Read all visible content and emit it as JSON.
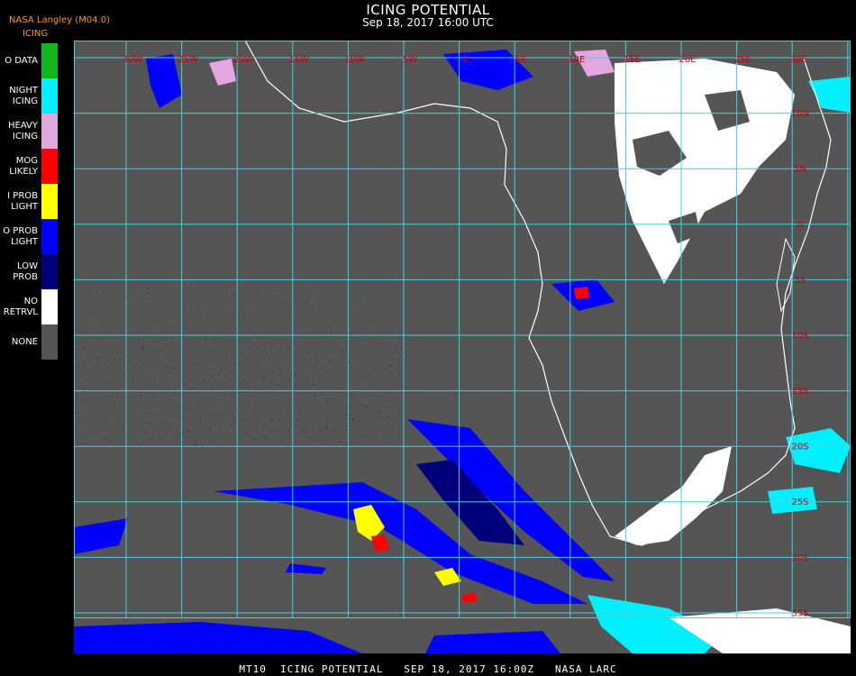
{
  "header": {
    "title": "ICING POTENTIAL",
    "datetime": "Sep 18, 2017 16:00 UTC",
    "source": "NASA Langley (M04.0)",
    "product": "ICING"
  },
  "legend": [
    {
      "label": "O DATA",
      "color": "#11b81b"
    },
    {
      "label": "NIGHT\nICING",
      "color": "#00f0ff"
    },
    {
      "label": "HEAVY\nICING",
      "color": "#e3a6e0"
    },
    {
      "label": "MOG\nLIKELY",
      "color": "#ff0000"
    },
    {
      "label": "I PROB\nLIGHT",
      "color": "#ffff00"
    },
    {
      "label": "O PROB\nLIGHT",
      "color": "#0000ff"
    },
    {
      "label": "LOW\nPROB",
      "color": "#00007a"
    },
    {
      "label": "NO\nRETRVL",
      "color": "#ffffff"
    },
    {
      "label": "NONE",
      "color": "#555555"
    }
  ],
  "map": {
    "background_color": "#555555",
    "grid_color": "#3fd3df",
    "coast_color": "#ffffff",
    "label_color": "#cc0000",
    "lon_labels": [
      "30W",
      "25W",
      "20W",
      "15W",
      "10W",
      "5W",
      "0",
      "5E",
      "10E",
      "15E",
      "20E",
      "25E",
      "30E",
      "35E",
      "40E"
    ],
    "lat_labels": [
      "10N",
      "5N",
      "0",
      "5S",
      "10S",
      "15S",
      "20S",
      "25S",
      "30S",
      "35S",
      "40S"
    ]
  },
  "footer": "MT10  ICING POTENTIAL   SEP 18, 2017 16:00Z   NASA LARC"
}
